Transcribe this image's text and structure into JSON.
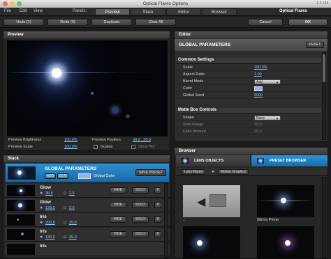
{
  "window": {
    "title": "Optical Flares Options",
    "version": "1.2.134"
  },
  "menu": {
    "items": [
      "File",
      "Edit",
      "View"
    ],
    "panels_label": "Panels:",
    "brand": "Optical Flares"
  },
  "panel_tabs": [
    "Preview",
    "Stack",
    "Editor",
    "Browser"
  ],
  "toolbar": {
    "undo": "Undo (1)",
    "redo": "Redo (0)",
    "duplicate": "Duplicate",
    "clear_all": "Clear All",
    "cancel": "Cancel",
    "ok": "OK"
  },
  "preview": {
    "title": "Preview",
    "brightness_label": "Preview Brightness",
    "brightness_value": "100.0%",
    "scale_label": "Preview Scale",
    "scale_value": "100.0%",
    "position_label": "Preview Position",
    "position_value": "30.0 , 30.0",
    "guides_label": "Guides",
    "show_bg_label": "Show BG"
  },
  "editor": {
    "title": "Editor",
    "header": "GLOBAL PARAMETERS",
    "reset": "RESET",
    "common_title": "Common Settings",
    "common": [
      {
        "name": "Scale",
        "value": "100.0%"
      },
      {
        "name": "Aspect Ratio",
        "value": "1.00"
      },
      {
        "name": "Blend Mode",
        "value": "Add"
      },
      {
        "name": "Color",
        "value": ""
      },
      {
        "name": "Global Seed",
        "value": "5000"
      }
    ],
    "matte_title": "Matte Box Controls",
    "matte": [
      {
        "name": "Shape",
        "value": "None"
      },
      {
        "name": "Start Range",
        "value": "25.0"
      },
      {
        "name": "Fade Amount",
        "value": "25.0"
      }
    ],
    "color_swatch": "#8ab6e8"
  },
  "stack": {
    "title": "Stack",
    "global": {
      "name": "GLOBAL PARAMETERS",
      "add": "ADD",
      "scn": "SCN",
      "color_label": "Global Color",
      "save_preset": "SAVE PRESET"
    },
    "items": [
      {
        "name": "Glow",
        "v1": "36.5",
        "v2": "2.5"
      },
      {
        "name": "Glow",
        "v1": "128.0",
        "v2": "2.5"
      },
      {
        "name": "Iris",
        "v1": "200.0",
        "v2": "25.0"
      },
      {
        "name": "Iris",
        "v1": "130.0",
        "v2": "25.0"
      },
      {
        "name": "Iris",
        "v1": "",
        "v2": ""
      }
    ],
    "hide": "HIDE",
    "solo": "SOLO",
    "close": "X"
  },
  "browser": {
    "title": "Browser",
    "tab_lens": "LENS OBJECTS",
    "tab_preset": "PRESET BROWSER",
    "crumbs": [
      "Lens Flares",
      "Motion Graphics"
    ],
    "tiles": [
      {
        "label": "..",
        "kind": "back"
      },
      {
        "label": "50mm Prime",
        "kind": "flare"
      },
      {
        "label": "",
        "kind": "flare"
      },
      {
        "label": "",
        "kind": "flare"
      }
    ]
  },
  "colors": {
    "accent": "#1f7ec0",
    "link": "#8fc5ff"
  }
}
